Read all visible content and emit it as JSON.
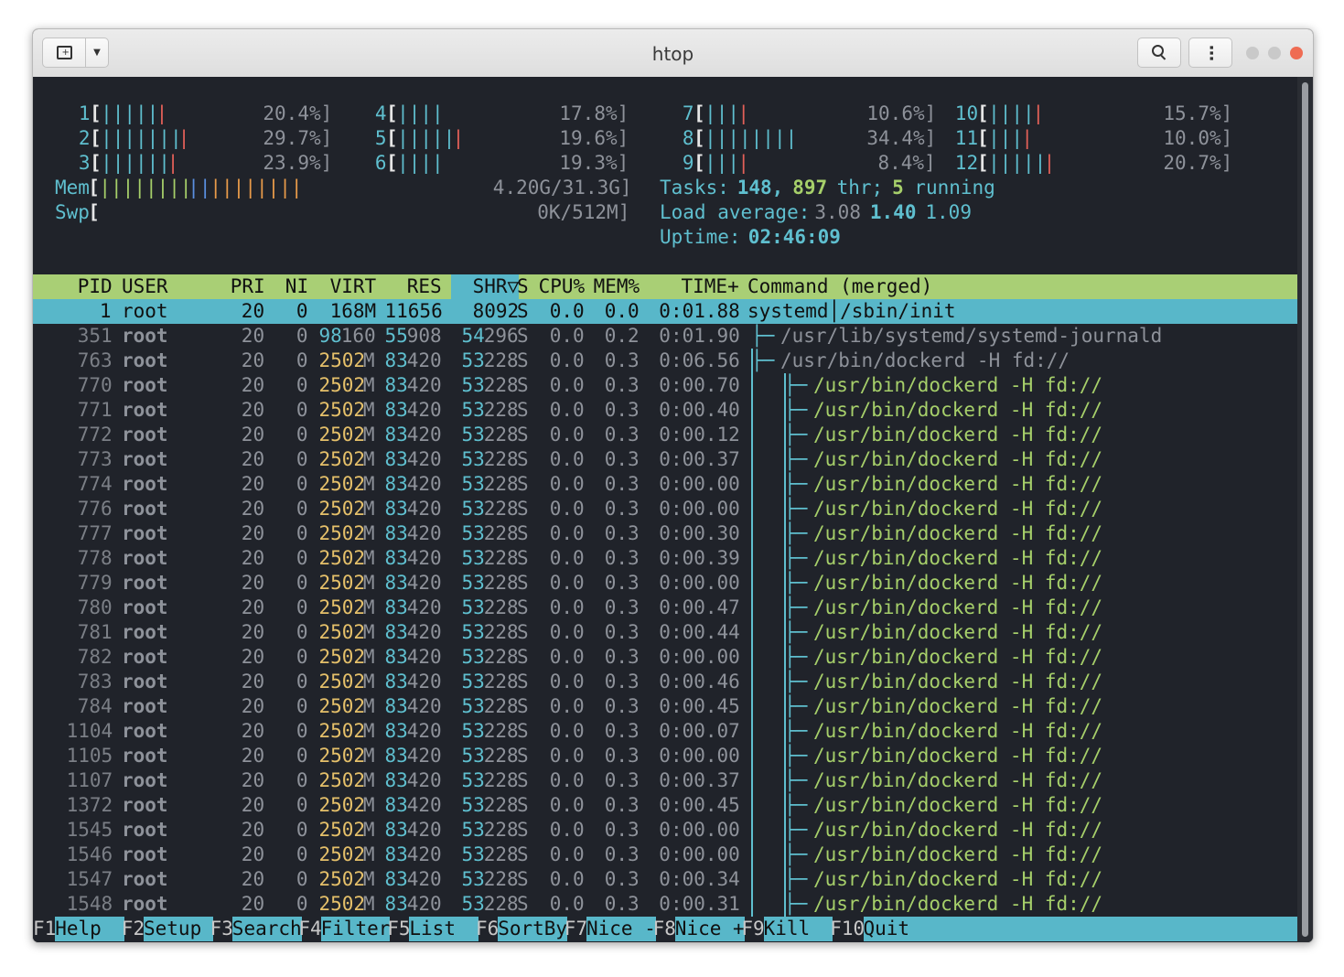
{
  "window": {
    "title": "htop"
  },
  "meters": {
    "cpus": [
      {
        "label": "1",
        "bars": [
          [
            "|||||",
            "cyan"
          ],
          [
            "|",
            "red"
          ]
        ],
        "value": "20.4%]"
      },
      {
        "label": "2",
        "bars": [
          [
            "|||||||",
            "cyan"
          ],
          [
            "|",
            "red"
          ]
        ],
        "value": "29.7%]"
      },
      {
        "label": "3",
        "bars": [
          [
            "||||||",
            "cyan"
          ],
          [
            "|",
            "red"
          ]
        ],
        "value": "23.9%]"
      },
      {
        "label": "4",
        "bars": [
          [
            "||||",
            "cyan"
          ]
        ],
        "value": "17.8%]"
      },
      {
        "label": "5",
        "bars": [
          [
            "|||||",
            "cyan"
          ],
          [
            "|",
            "red"
          ]
        ],
        "value": "19.6%]"
      },
      {
        "label": "6",
        "bars": [
          [
            "||||",
            "cyan"
          ]
        ],
        "value": "19.3%]"
      },
      {
        "label": "7",
        "bars": [
          [
            "|||",
            "cyan"
          ],
          [
            "|",
            "red"
          ]
        ],
        "value": "10.6%]"
      },
      {
        "label": "8",
        "bars": [
          [
            "||||||||",
            "cyan"
          ]
        ],
        "value": "34.4%]"
      },
      {
        "label": "9",
        "bars": [
          [
            "|||",
            "cyan"
          ],
          [
            "|",
            "red"
          ]
        ],
        "value": "8.4%]"
      },
      {
        "label": "10",
        "bars": [
          [
            "||||",
            "cyan"
          ],
          [
            "|",
            "red"
          ]
        ],
        "value": "15.7%]"
      },
      {
        "label": "11",
        "bars": [
          [
            "|||",
            "cyan"
          ],
          [
            "|",
            "red"
          ]
        ],
        "value": "10.0%]"
      },
      {
        "label": "12",
        "bars": [
          [
            "|||||",
            "cyan"
          ],
          [
            "|",
            "red"
          ]
        ],
        "value": "20.7%]"
      }
    ],
    "mem": {
      "label": "Mem",
      "bars": [
        [
          "||||||||",
          "green"
        ],
        [
          "||",
          "blue"
        ],
        [
          "||||||||",
          "orange"
        ]
      ],
      "value": "4.20G/31.3G]"
    },
    "swp": {
      "label": "Swp",
      "value": "0K/512M]"
    },
    "tasks": {
      "label": "Tasks:",
      "procs": "148,",
      "threads": "897",
      "thr": "thr;",
      "running": "5",
      "running_label": "running"
    },
    "load": {
      "label": "Load average:",
      "l1": "3.08",
      "l5": "1.40",
      "l15": "1.09"
    },
    "uptime": {
      "label": "Uptime:",
      "value": "02:46:09"
    }
  },
  "header": {
    "pid": "PID",
    "user": "USER",
    "pri": "PRI",
    "ni": "NI",
    "virt": "VIRT",
    "res": "RES",
    "shr": "SHR▽",
    "s": "S",
    "cpu": "CPU%",
    "mem": "MEM%",
    "time": "TIME+",
    "command": "Command (merged)"
  },
  "processes": [
    {
      "pid": "1",
      "user": "root",
      "pri": "20",
      "ni": "0",
      "virt": "168M",
      "res": "11656",
      "shr": "8092",
      "s": "S",
      "cpu": "0.0",
      "mem": "0.0",
      "time": "0:01.88",
      "tree": "",
      "cmd": "systemd│/sbin/init",
      "selected": true
    },
    {
      "pid": "351",
      "user": "root",
      "pri": "20",
      "ni": "0",
      "virt": "98160",
      "res": "55908",
      "shr": "54296",
      "s": "S",
      "cpu": "0.0",
      "mem": "0.2",
      "time": "0:01.90",
      "tree": "├─ ",
      "cmd": "/usr/lib/systemd/systemd-journald",
      "level": 1
    },
    {
      "pid": "763",
      "user": "root",
      "pri": "20",
      "ni": "0",
      "virt": "2502M",
      "res": "83420",
      "shr": "53228",
      "s": "S",
      "cpu": "0.0",
      "mem": "0.3",
      "time": "0:06.56",
      "tree": "├─ ",
      "cmd": "/usr/bin/dockerd -H fd://",
      "level": 1
    },
    {
      "pid": "770",
      "user": "root",
      "pri": "20",
      "ni": "0",
      "virt": "2502M",
      "res": "83420",
      "shr": "53228",
      "s": "S",
      "cpu": "0.0",
      "mem": "0.3",
      "time": "0:00.70",
      "tree": "│  ├─ ",
      "cmd": "/usr/bin/dockerd -H fd://",
      "level": 2
    },
    {
      "pid": "771",
      "user": "root",
      "pri": "20",
      "ni": "0",
      "virt": "2502M",
      "res": "83420",
      "shr": "53228",
      "s": "S",
      "cpu": "0.0",
      "mem": "0.3",
      "time": "0:00.40",
      "tree": "│  ├─ ",
      "cmd": "/usr/bin/dockerd -H fd://",
      "level": 2
    },
    {
      "pid": "772",
      "user": "root",
      "pri": "20",
      "ni": "0",
      "virt": "2502M",
      "res": "83420",
      "shr": "53228",
      "s": "S",
      "cpu": "0.0",
      "mem": "0.3",
      "time": "0:00.12",
      "tree": "│  ├─ ",
      "cmd": "/usr/bin/dockerd -H fd://",
      "level": 2
    },
    {
      "pid": "773",
      "user": "root",
      "pri": "20",
      "ni": "0",
      "virt": "2502M",
      "res": "83420",
      "shr": "53228",
      "s": "S",
      "cpu": "0.0",
      "mem": "0.3",
      "time": "0:00.37",
      "tree": "│  ├─ ",
      "cmd": "/usr/bin/dockerd -H fd://",
      "level": 2
    },
    {
      "pid": "774",
      "user": "root",
      "pri": "20",
      "ni": "0",
      "virt": "2502M",
      "res": "83420",
      "shr": "53228",
      "s": "S",
      "cpu": "0.0",
      "mem": "0.3",
      "time": "0:00.00",
      "tree": "│  ├─ ",
      "cmd": "/usr/bin/dockerd -H fd://",
      "level": 2
    },
    {
      "pid": "776",
      "user": "root",
      "pri": "20",
      "ni": "0",
      "virt": "2502M",
      "res": "83420",
      "shr": "53228",
      "s": "S",
      "cpu": "0.0",
      "mem": "0.3",
      "time": "0:00.00",
      "tree": "│  ├─ ",
      "cmd": "/usr/bin/dockerd -H fd://",
      "level": 2
    },
    {
      "pid": "777",
      "user": "root",
      "pri": "20",
      "ni": "0",
      "virt": "2502M",
      "res": "83420",
      "shr": "53228",
      "s": "S",
      "cpu": "0.0",
      "mem": "0.3",
      "time": "0:00.30",
      "tree": "│  ├─ ",
      "cmd": "/usr/bin/dockerd -H fd://",
      "level": 2
    },
    {
      "pid": "778",
      "user": "root",
      "pri": "20",
      "ni": "0",
      "virt": "2502M",
      "res": "83420",
      "shr": "53228",
      "s": "S",
      "cpu": "0.0",
      "mem": "0.3",
      "time": "0:00.39",
      "tree": "│  ├─ ",
      "cmd": "/usr/bin/dockerd -H fd://",
      "level": 2
    },
    {
      "pid": "779",
      "user": "root",
      "pri": "20",
      "ni": "0",
      "virt": "2502M",
      "res": "83420",
      "shr": "53228",
      "s": "S",
      "cpu": "0.0",
      "mem": "0.3",
      "time": "0:00.00",
      "tree": "│  ├─ ",
      "cmd": "/usr/bin/dockerd -H fd://",
      "level": 2
    },
    {
      "pid": "780",
      "user": "root",
      "pri": "20",
      "ni": "0",
      "virt": "2502M",
      "res": "83420",
      "shr": "53228",
      "s": "S",
      "cpu": "0.0",
      "mem": "0.3",
      "time": "0:00.47",
      "tree": "│  ├─ ",
      "cmd": "/usr/bin/dockerd -H fd://",
      "level": 2
    },
    {
      "pid": "781",
      "user": "root",
      "pri": "20",
      "ni": "0",
      "virt": "2502M",
      "res": "83420",
      "shr": "53228",
      "s": "S",
      "cpu": "0.0",
      "mem": "0.3",
      "time": "0:00.44",
      "tree": "│  ├─ ",
      "cmd": "/usr/bin/dockerd -H fd://",
      "level": 2
    },
    {
      "pid": "782",
      "user": "root",
      "pri": "20",
      "ni": "0",
      "virt": "2502M",
      "res": "83420",
      "shr": "53228",
      "s": "S",
      "cpu": "0.0",
      "mem": "0.3",
      "time": "0:00.00",
      "tree": "│  ├─ ",
      "cmd": "/usr/bin/dockerd -H fd://",
      "level": 2
    },
    {
      "pid": "783",
      "user": "root",
      "pri": "20",
      "ni": "0",
      "virt": "2502M",
      "res": "83420",
      "shr": "53228",
      "s": "S",
      "cpu": "0.0",
      "mem": "0.3",
      "time": "0:00.46",
      "tree": "│  ├─ ",
      "cmd": "/usr/bin/dockerd -H fd://",
      "level": 2
    },
    {
      "pid": "784",
      "user": "root",
      "pri": "20",
      "ni": "0",
      "virt": "2502M",
      "res": "83420",
      "shr": "53228",
      "s": "S",
      "cpu": "0.0",
      "mem": "0.3",
      "time": "0:00.45",
      "tree": "│  ├─ ",
      "cmd": "/usr/bin/dockerd -H fd://",
      "level": 2
    },
    {
      "pid": "1104",
      "user": "root",
      "pri": "20",
      "ni": "0",
      "virt": "2502M",
      "res": "83420",
      "shr": "53228",
      "s": "S",
      "cpu": "0.0",
      "mem": "0.3",
      "time": "0:00.07",
      "tree": "│  ├─ ",
      "cmd": "/usr/bin/dockerd -H fd://",
      "level": 2
    },
    {
      "pid": "1105",
      "user": "root",
      "pri": "20",
      "ni": "0",
      "virt": "2502M",
      "res": "83420",
      "shr": "53228",
      "s": "S",
      "cpu": "0.0",
      "mem": "0.3",
      "time": "0:00.00",
      "tree": "│  ├─ ",
      "cmd": "/usr/bin/dockerd -H fd://",
      "level": 2
    },
    {
      "pid": "1107",
      "user": "root",
      "pri": "20",
      "ni": "0",
      "virt": "2502M",
      "res": "83420",
      "shr": "53228",
      "s": "S",
      "cpu": "0.0",
      "mem": "0.3",
      "time": "0:00.37",
      "tree": "│  ├─ ",
      "cmd": "/usr/bin/dockerd -H fd://",
      "level": 2
    },
    {
      "pid": "1372",
      "user": "root",
      "pri": "20",
      "ni": "0",
      "virt": "2502M",
      "res": "83420",
      "shr": "53228",
      "s": "S",
      "cpu": "0.0",
      "mem": "0.3",
      "time": "0:00.45",
      "tree": "│  ├─ ",
      "cmd": "/usr/bin/dockerd -H fd://",
      "level": 2
    },
    {
      "pid": "1545",
      "user": "root",
      "pri": "20",
      "ni": "0",
      "virt": "2502M",
      "res": "83420",
      "shr": "53228",
      "s": "S",
      "cpu": "0.0",
      "mem": "0.3",
      "time": "0:00.00",
      "tree": "│  ├─ ",
      "cmd": "/usr/bin/dockerd -H fd://",
      "level": 2
    },
    {
      "pid": "1546",
      "user": "root",
      "pri": "20",
      "ni": "0",
      "virt": "2502M",
      "res": "83420",
      "shr": "53228",
      "s": "S",
      "cpu": "0.0",
      "mem": "0.3",
      "time": "0:00.00",
      "tree": "│  ├─ ",
      "cmd": "/usr/bin/dockerd -H fd://",
      "level": 2
    },
    {
      "pid": "1547",
      "user": "root",
      "pri": "20",
      "ni": "0",
      "virt": "2502M",
      "res": "83420",
      "shr": "53228",
      "s": "S",
      "cpu": "0.0",
      "mem": "0.3",
      "time": "0:00.34",
      "tree": "│  ├─ ",
      "cmd": "/usr/bin/dockerd -H fd://",
      "level": 2
    },
    {
      "pid": "1548",
      "user": "root",
      "pri": "20",
      "ni": "0",
      "virt": "2502M",
      "res": "83420",
      "shr": "53228",
      "s": "S",
      "cpu": "0.0",
      "mem": "0.3",
      "time": "0:00.31",
      "tree": "│  ├─ ",
      "cmd": "/usr/bin/dockerd -H fd://",
      "level": 2
    }
  ],
  "fkeys": [
    {
      "key": "F1",
      "label": "Help  "
    },
    {
      "key": "F2",
      "label": "Setup "
    },
    {
      "key": "F3",
      "label": "Search"
    },
    {
      "key": "F4",
      "label": "Filter"
    },
    {
      "key": "F5",
      "label": "List  "
    },
    {
      "key": "F6",
      "label": "SortBy"
    },
    {
      "key": "F7",
      "label": "Nice -"
    },
    {
      "key": "F8",
      "label": "Nice +"
    },
    {
      "key": "F9",
      "label": "Kill  "
    },
    {
      "key": "F10",
      "label": "Quit  "
    }
  ]
}
